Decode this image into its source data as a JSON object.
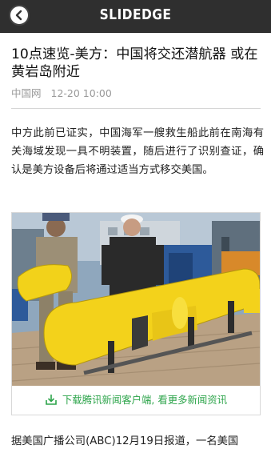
{
  "header": {
    "title": "SLIDEDGE",
    "back_icon": "chevron-left-icon"
  },
  "article": {
    "headline": "10点速览-美方：中国将交还潜航器 或在黄岩岛附近",
    "source": "中国网",
    "datetime": "12-20 10:00",
    "paragraph1": "中方此前已证实，中国海军一艘救生船此前在南海有关海域发现一具不明装置，随后进行了识别查证，确认是美方设备后将通过适当方式移交美国。",
    "paragraph2": "据美国广播公司(ABC)12月19日报道，一名美国"
  },
  "figure": {
    "promo_text": "下载腾讯新闻客户端, 看更多新闻资讯",
    "promo_icon": "download-icon",
    "promo_color": "#2ca44a"
  }
}
